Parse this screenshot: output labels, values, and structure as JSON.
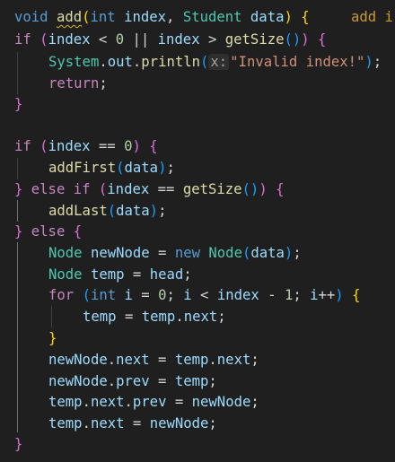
{
  "editor": {
    "language": "java",
    "error_lens_text": "add i",
    "lines": [
      "void add(int index, Student data) {",
      "if (index < 0 || index > getSize()) {",
      "System.out.println(x:\"Invalid index!\");",
      "return;",
      "}",
      "",
      "if (index == 0) {",
      "addFirst(data);",
      "} else if (index == getSize()) {",
      "addLast(data);",
      "} else {",
      "Node newNode = new Node(data);",
      "Node temp = head;",
      "for (int i = 0; i < index - 1; i++) {",
      "temp = temp.next;",
      "}",
      "newNode.next = temp.next;",
      "newNode.prev = temp;",
      "temp.next.prev = newNode;",
      "temp.next = newNode;",
      "}"
    ]
  },
  "tokens": {
    "void": "void",
    "add": "add",
    "int": "int",
    "index": "index",
    "student": "Student",
    "data": "data",
    "if": "if",
    "else": "else",
    "zero": "0",
    "one": "1",
    "getsize": "getSize",
    "system": "System",
    "out": "out",
    "println": "println",
    "hint_x": "x:",
    "invalid": "\"Invalid index!\"",
    "return": "return",
    "addfirst": "addFirst",
    "addlast": "addLast",
    "node": "Node",
    "newnode": "newNode",
    "new": "new",
    "temp": "temp",
    "head": "head",
    "for": "for",
    "i": "i",
    "next": "next",
    "prev": "prev"
  }
}
